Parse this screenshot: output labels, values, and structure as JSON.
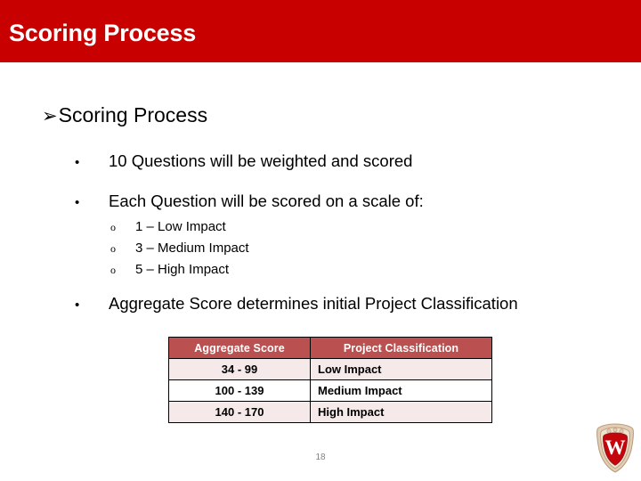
{
  "slide": {
    "title": "Scoring Process",
    "page_number": "18",
    "title_bar_color": "#C80000",
    "table_header_color": "#BB5050",
    "table_band_color": "#F5E9E9"
  },
  "content": {
    "heading": {
      "marker": "➢",
      "text": "Scoring Process"
    },
    "bullets": [
      {
        "marker": "•",
        "text": "10 Questions will be weighted and scored"
      },
      {
        "marker": "•",
        "text": "Each Question will be scored on a scale of:"
      },
      {
        "marker": "•",
        "text": "Aggregate Score determines initial Project Classification"
      }
    ],
    "sub_bullets": [
      {
        "marker": "o",
        "text": "1 – Low Impact"
      },
      {
        "marker": "o",
        "text": "3 – Medium Impact"
      },
      {
        "marker": "o",
        "text": "5 – High Impact"
      }
    ]
  },
  "table": {
    "headers": [
      "Aggregate Score",
      "Project Classification"
    ],
    "rows": [
      {
        "score": "34 - 99",
        "classification": "Low Impact"
      },
      {
        "score": "100 - 139",
        "classification": "Medium Impact"
      },
      {
        "score": "140 - 170",
        "classification": "High Impact"
      }
    ]
  },
  "logo": {
    "name": "uw-madison-crest",
    "letter": "W"
  }
}
